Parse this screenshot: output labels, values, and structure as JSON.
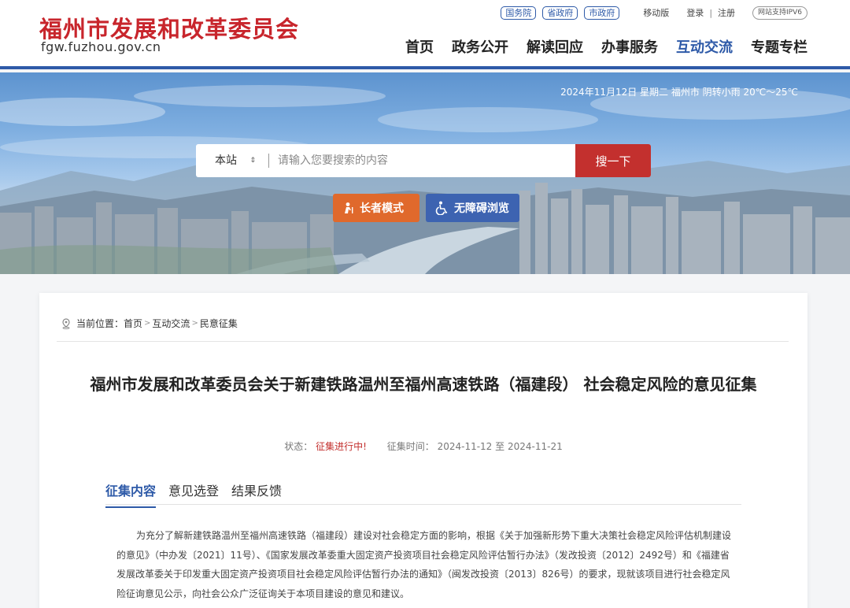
{
  "header": {
    "logo_cn": "福州市发展和改革委员会",
    "logo_en": "fgw.fuzhou.gov.cn",
    "gov_links": [
      "国务院",
      "省政府",
      "市政府"
    ],
    "mobile": "移动版",
    "login": "登录",
    "separator": "|",
    "register": "注册",
    "ipv6": "网站支持IPV6",
    "nav": [
      "首页",
      "政务公开",
      "解读回应",
      "办事服务",
      "互动交流",
      "专题专栏"
    ],
    "active_nav": "互动交流"
  },
  "banner": {
    "weather": "2024年11月12日 星期二 福州市 阴转小雨 20℃～25℃",
    "search_scope": "本站",
    "search_scope_arrow": "⇕",
    "search_placeholder": "请输入您要搜索的内容",
    "search_button": "搜一下",
    "elder_mode": "长者模式",
    "accessibility": "无障碍浏览"
  },
  "breadcrumb": {
    "label": "当前位置：",
    "items": [
      "首页",
      "互动交流",
      "民意征集"
    ],
    "sep": ">"
  },
  "article": {
    "title": "福州市发展和改革委员会关于新建铁路温州至福州高速铁路（福建段） 社会稳定风险的意见征集",
    "status_label": "状态：",
    "status_value": "征集进行中!",
    "time_label": "征集时间：",
    "time_start": "2024-11-12",
    "time_to": "至",
    "time_end": "2024-11-21",
    "tabs": [
      "征集内容",
      "意见选登",
      "结果反馈"
    ],
    "active_tab": "征集内容",
    "body": "为充分了解新建铁路温州至福州高速铁路（福建段）建设对社会稳定方面的影响，根据《关于加强新形势下重大决策社会稳定风险评估机制建设的意见》（中办发〔2021〕11号）、《国家发展改革委重大固定资产投资项目社会稳定风险评估暂行办法》（发改投资〔2012〕2492号）和《福建省发展改革委关于印发重大固定资产投资项目社会稳定风险评估暂行办法的通知》（闽发改投资〔2013〕826号）的要求，现就该项目进行社会稳定风险征询意见公示，向社会公众广泛征询关于本项目建设的意见和建议。"
  },
  "colors": {
    "brand_red": "#c8252c",
    "brand_blue": "#2e5aa8",
    "search_button": "#c3302e",
    "elder_button": "#e0692c",
    "access_button": "#3d63b1"
  }
}
